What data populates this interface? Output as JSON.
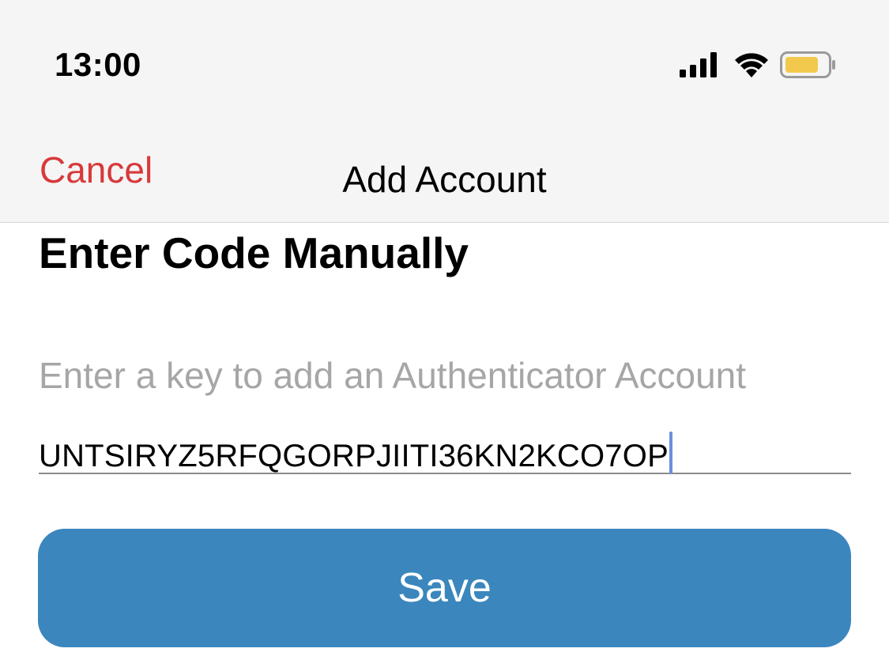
{
  "status_bar": {
    "time": "13:00",
    "signal_icon": "cellular-signal-icon",
    "wifi_icon": "wifi-icon",
    "battery_icon": "battery-icon",
    "battery_color": "#f2c94c"
  },
  "nav": {
    "cancel_label": "Cancel",
    "title": "Add Account",
    "cancel_color": "#d8393a"
  },
  "main": {
    "heading": "Enter Code Manually",
    "key_placeholder": "Enter a key to add an Authenticator Account",
    "key_value": "UNTSIRYZ5RFQGORPJIITI36KN2KCO7OP",
    "save_label": "Save",
    "save_color": "#3b86bd"
  }
}
